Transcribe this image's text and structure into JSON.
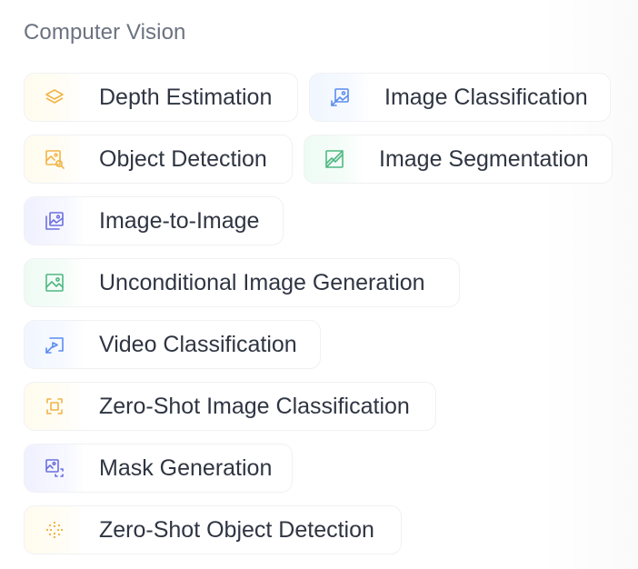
{
  "section": {
    "title": "Computer Vision"
  },
  "colors": {
    "yellow": "#f2b447",
    "blue": "#5b8def",
    "green": "#4fb883",
    "indigo": "#6d6fe0",
    "text": "#2f3542",
    "muted": "#6b7280"
  },
  "tags": [
    {
      "label": "Depth Estimation",
      "icon": "layers-icon",
      "tint": "yellow"
    },
    {
      "label": "Image Classification",
      "icon": "image-classification-icon",
      "tint": "blue"
    },
    {
      "label": "Object Detection",
      "icon": "object-detection-icon",
      "tint": "yellow"
    },
    {
      "label": "Image Segmentation",
      "icon": "image-segmentation-icon",
      "tint": "green"
    },
    {
      "label": "Image-to-Image",
      "icon": "image-to-image-icon",
      "tint": "indigo"
    },
    {
      "label": "Unconditional Image Generation",
      "icon": "image-icon",
      "tint": "green"
    },
    {
      "label": "Video Classification",
      "icon": "video-classification-icon",
      "tint": "blue"
    },
    {
      "label": "Zero-Shot Image Classification",
      "icon": "zero-shot-image-icon",
      "tint": "yellow"
    },
    {
      "label": "Mask Generation",
      "icon": "mask-generation-icon",
      "tint": "indigo"
    },
    {
      "label": "Zero-Shot Object Detection",
      "icon": "zero-shot-object-icon",
      "tint": "yellow"
    }
  ]
}
